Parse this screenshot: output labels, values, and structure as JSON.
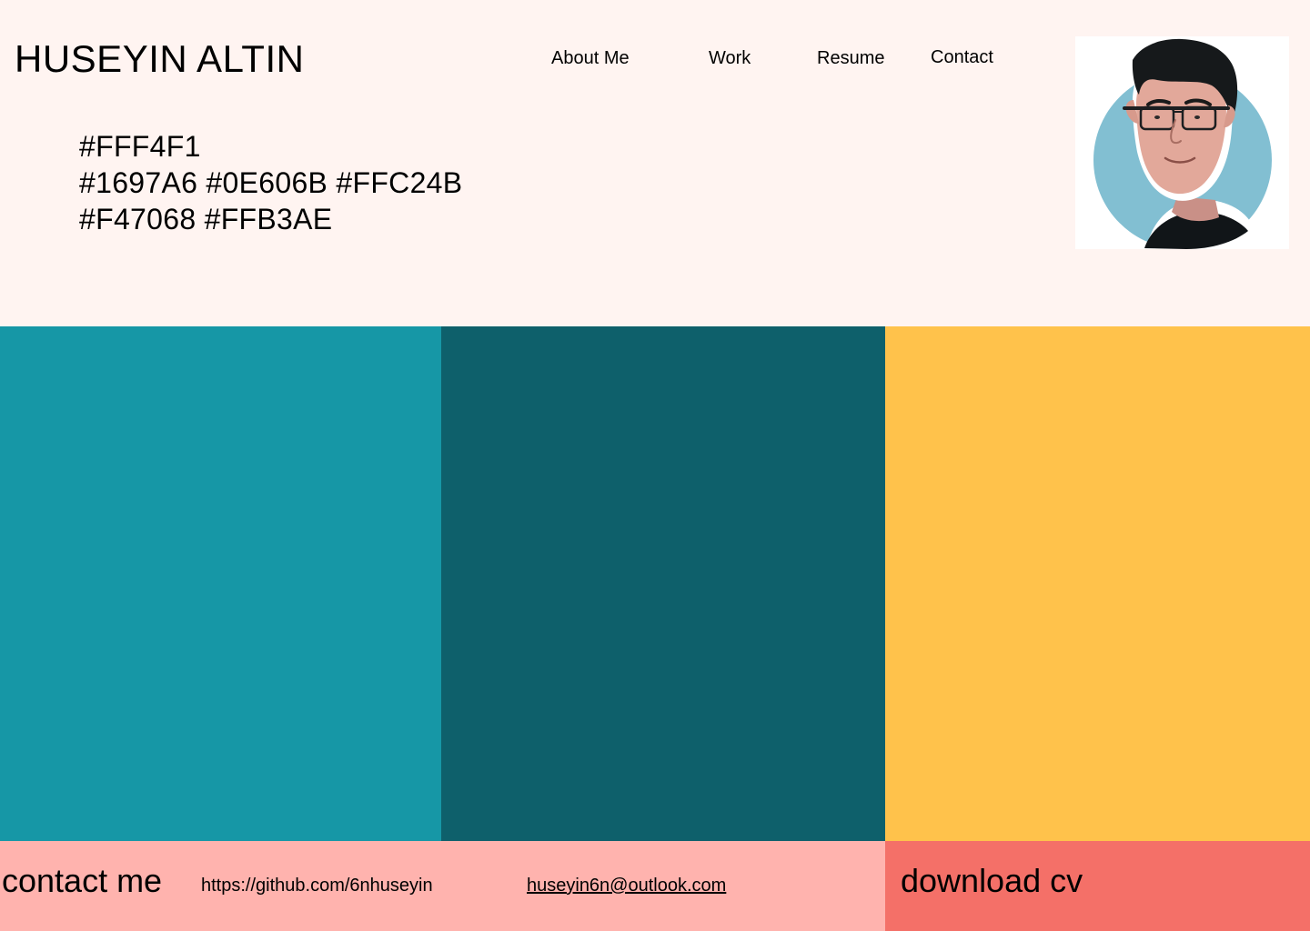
{
  "header": {
    "brand": "HUSEYIN ALTIN",
    "nav": {
      "about": "About Me",
      "work": "Work",
      "resume": "Resume",
      "contact": "Contact"
    }
  },
  "palette": {
    "line1": "#FFF4F1",
    "line2": "#1697A6 #0E606B #FFC24B",
    "line3": "#F47068 #FFB3AE",
    "colors": {
      "background": "#FFF4F1",
      "teal": "#1697A6",
      "dark_teal": "#0E606B",
      "yellow": "#FFC24B",
      "coral": "#F47068",
      "pink": "#FFB3AE"
    }
  },
  "avatar": {
    "icon": "avatar-illustration"
  },
  "footer": {
    "contact_heading": "contact me",
    "github": "https://github.com/6nhuseyin",
    "email": "huseyin6n@outlook.com",
    "download": "download cv"
  }
}
